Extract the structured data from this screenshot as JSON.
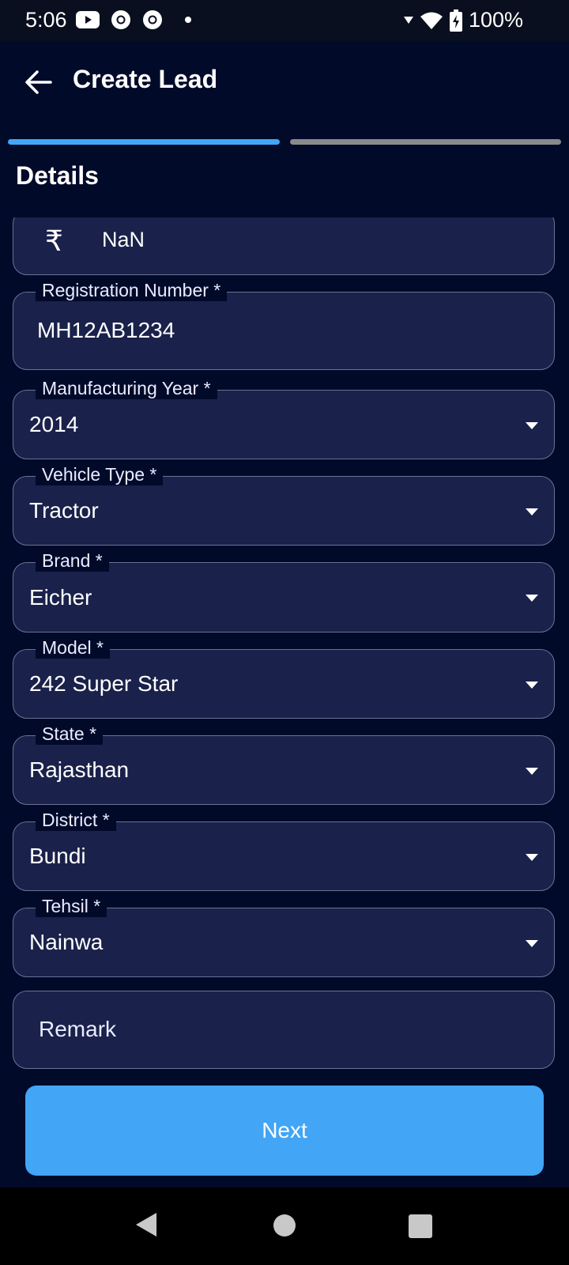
{
  "status_bar": {
    "time": "5:06",
    "battery": "100%",
    "icons": [
      "youtube-icon",
      "chrome-icon",
      "chrome-icon",
      "dot-icon",
      "wifi-icon",
      "battery-icon"
    ]
  },
  "app_bar": {
    "title": "Create Lead",
    "back_icon": "arrow-back-icon"
  },
  "progress": {
    "steps": 2,
    "current_step": 1
  },
  "section": {
    "title": "Details"
  },
  "form": {
    "price": {
      "currency_symbol": "₹",
      "value": "NaN"
    },
    "registration_number": {
      "label": "Registration Number *",
      "value": "MH12AB1234"
    },
    "manufacturing_year": {
      "label": "Manufacturing Year *",
      "value": "2014"
    },
    "vehicle_type": {
      "label": "Vehicle Type *",
      "value": "Tractor"
    },
    "brand": {
      "label": "Brand *",
      "value": "Eicher"
    },
    "model": {
      "label": "Model *",
      "value": "242 Super Star"
    },
    "state": {
      "label": "State *",
      "value": "Rajasthan"
    },
    "district": {
      "label": "District *",
      "value": "Bundi"
    },
    "tehsil": {
      "label": "Tehsil *",
      "value": "Nainwa"
    },
    "remark": {
      "placeholder": "Remark"
    }
  },
  "actions": {
    "next_label": "Next"
  },
  "colors": {
    "background": "#020a2a",
    "field_background": "#1a214a",
    "accent": "#42a5f5",
    "inactive_progress": "#8a8a8a"
  }
}
